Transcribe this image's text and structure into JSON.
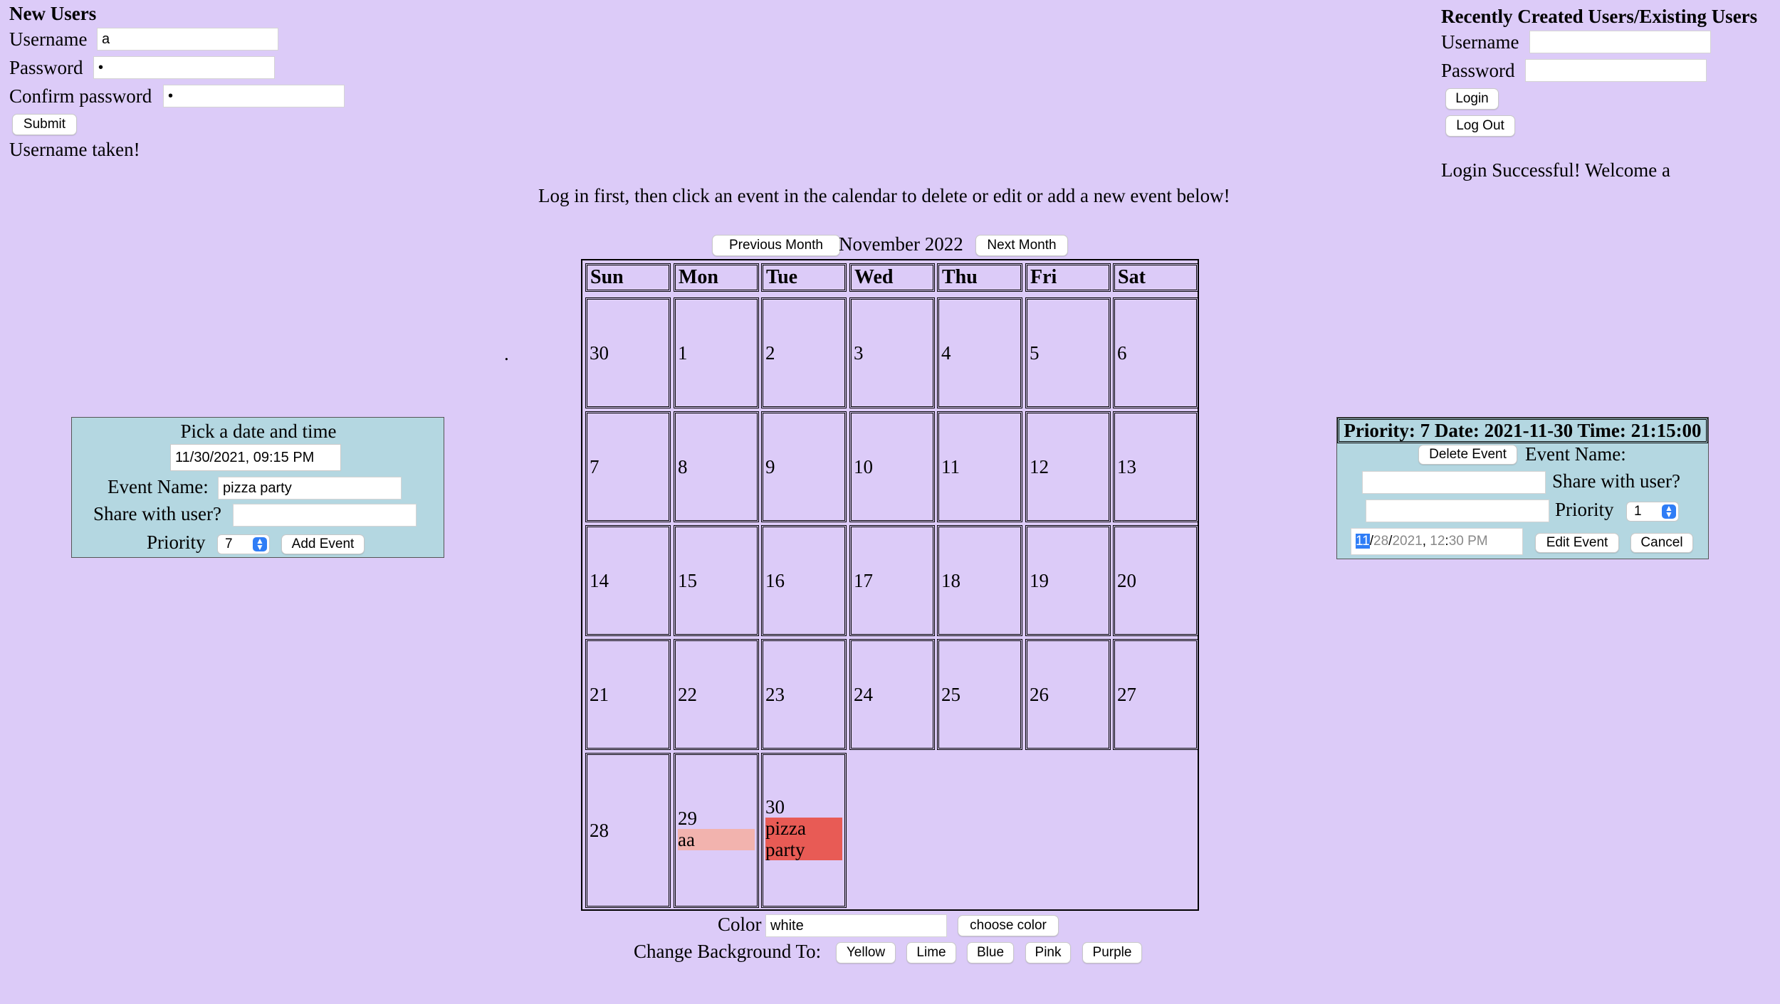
{
  "new_users": {
    "title": "New Users",
    "username_label": "Username",
    "username_value": "a",
    "password_label": "Password",
    "password_value": "•",
    "confirm_label": "Confirm password",
    "confirm_value": "•",
    "submit_label": "Submit",
    "status": "Username taken!"
  },
  "existing_users": {
    "title": "Recently Created Users/Existing Users",
    "username_label": "Username",
    "password_label": "Password",
    "login_label": "Login",
    "logout_label": "Log Out",
    "status": "Login Successful! Welcome a"
  },
  "instructions": "Log in first, then click an event in the calendar to delete or edit or add a new event below!",
  "stray_dot": ".",
  "calendar_nav": {
    "prev_label": "Previous Month",
    "month_title": "November 2022",
    "next_label": "Next Month"
  },
  "calendar": {
    "weekdays": [
      "Sun",
      "Mon",
      "Tue",
      "Wed",
      "Thu",
      "Fri",
      "Sat"
    ],
    "weeks": [
      [
        "30",
        "1",
        "2",
        "3",
        "4",
        "5",
        "6"
      ],
      [
        "7",
        "8",
        "9",
        "10",
        "11",
        "12",
        "13"
      ],
      [
        "14",
        "15",
        "16",
        "17",
        "18",
        "19",
        "20"
      ],
      [
        "21",
        "22",
        "23",
        "24",
        "25",
        "26",
        "27"
      ],
      [
        "28",
        "29",
        "30"
      ]
    ],
    "events": [
      {
        "week": 4,
        "day": 1,
        "text": "aa",
        "color": "#f2b3ae"
      },
      {
        "week": 4,
        "day": 2,
        "text": "pizza party",
        "color": "#e85b55"
      }
    ]
  },
  "add_event": {
    "title": "Pick a date and time",
    "datetime_value": "11/30/2021, 09:15 PM",
    "event_name_label": "Event Name:",
    "event_name_value": "pizza party",
    "share_label": "Share with user?",
    "share_value": "",
    "priority_label": "Priority",
    "priority_value": "7",
    "add_label": "Add Event"
  },
  "edit_event": {
    "header": "Priority: 7 Date: 2021-11-30 Time: 21:15:00",
    "delete_label": "Delete Event",
    "event_name_label": "Event Name:",
    "share_label": "Share with user?",
    "priority_label": "Priority",
    "priority_value": "1",
    "date_month": "11",
    "date_day": "28",
    "date_year": "2021",
    "time_hour": "12",
    "time_rest": "30 PM",
    "edit_label": "Edit Event",
    "cancel_label": "Cancel"
  },
  "color_picker": {
    "label": "Color",
    "value": "white",
    "choose_label": "choose color"
  },
  "background": {
    "label": "Change Background To:",
    "options": [
      "Yellow",
      "Lime",
      "Blue",
      "Pink",
      "Purple"
    ]
  },
  "colors": {
    "page_bg": "#dccbf8",
    "panel_bg": "#b4d7e1",
    "accent": "#2f7df6"
  }
}
